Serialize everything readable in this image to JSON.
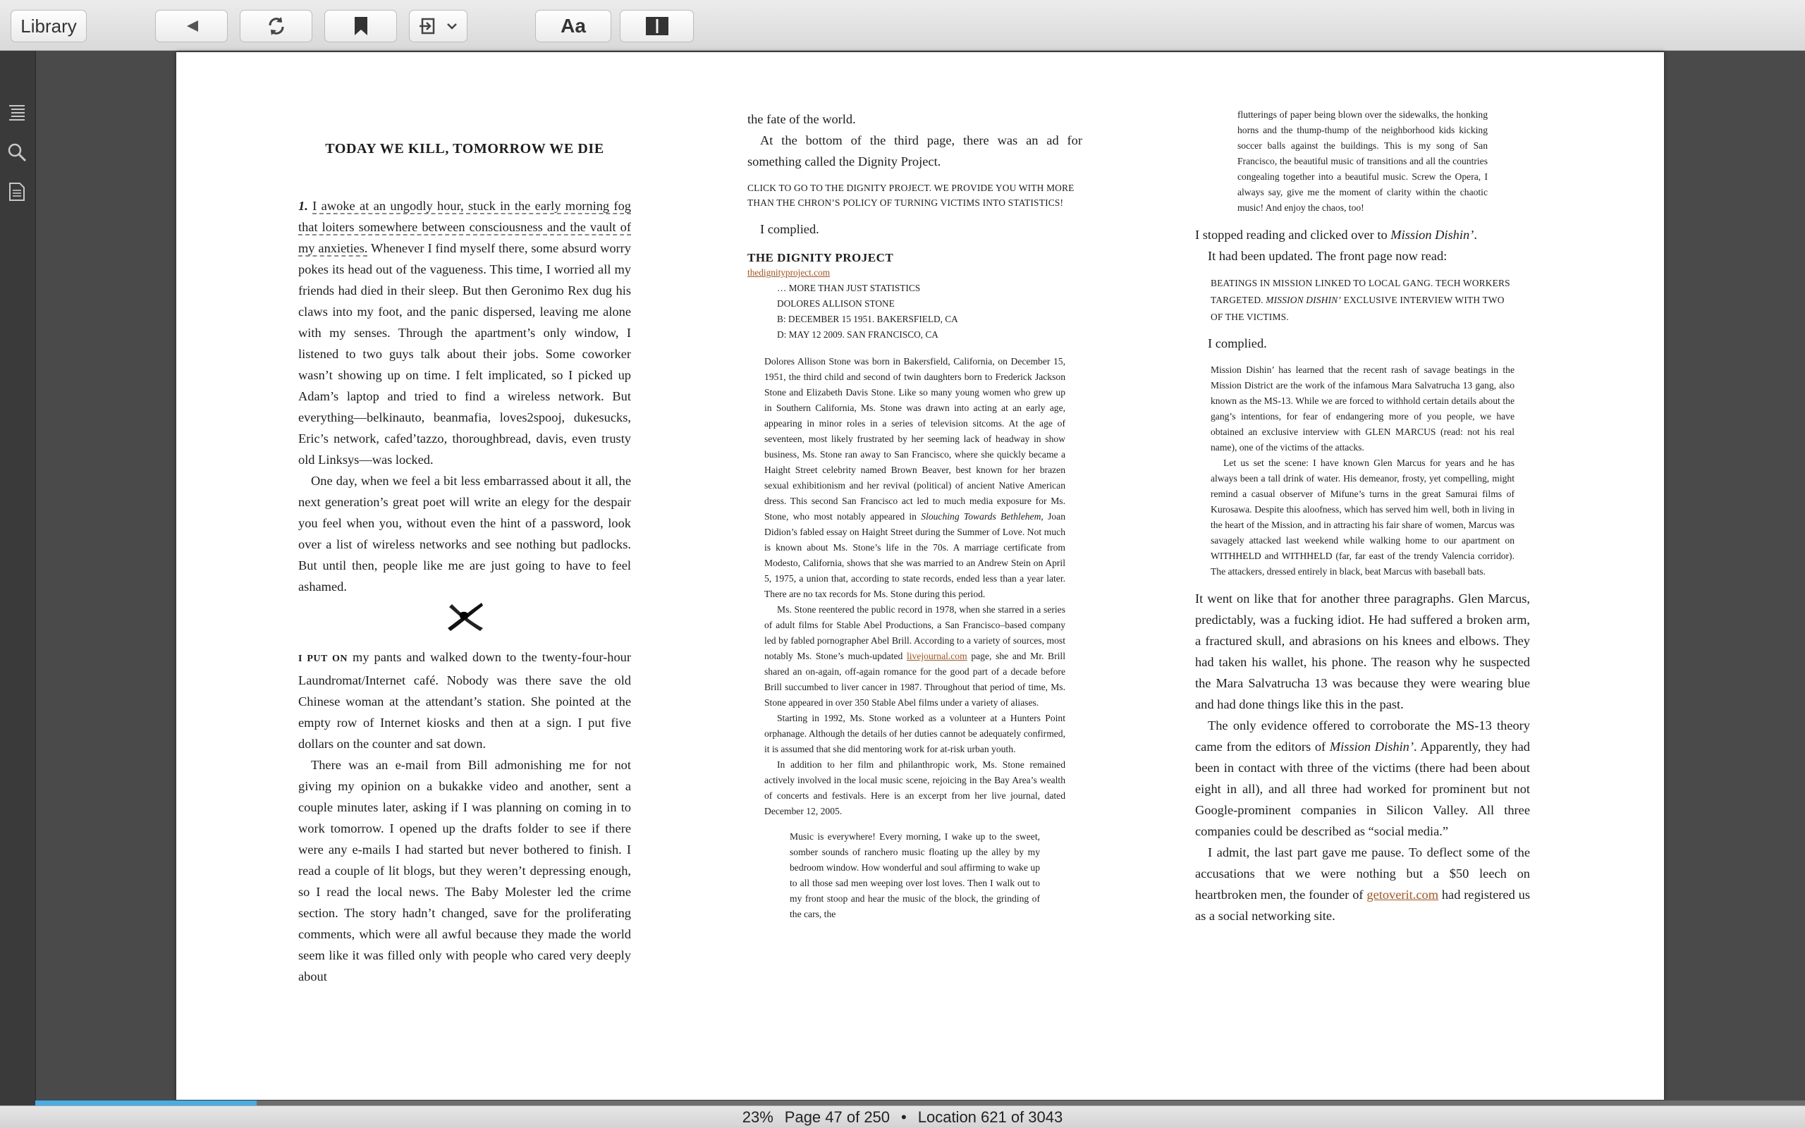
{
  "toolbar": {
    "library_label": "Library",
    "font_label": "Aa",
    "icons": [
      "back-icon",
      "refresh-icon",
      "bookmark-icon",
      "export-icon",
      "chevron-down-icon",
      "font-icon",
      "layout-icon"
    ]
  },
  "sidebar": {
    "icons": [
      "toc-icon",
      "search-icon",
      "notes-icon"
    ]
  },
  "col1": {
    "chapter_title": "TODAY WE KILL, TOMORROW WE DIE",
    "p1_num": "1.",
    "p1_underlined": "I awoke at an ungodly hour, stuck in the early morning fog that loiters somewhere between consciousness and the vault of my anxieties.",
    "p1_rest": " Whenever I find myself there, some absurd worry pokes its head out of the vagueness. This time, I worried all my friends had died in their sleep. But then Geronimo Rex dug his claws into my foot, and the panic dispersed, leaving me alone with my senses. Through the apartment’s only window, I listened to two guys talk about their jobs. Some coworker wasn’t showing up on time. I felt implicated, so I picked up Adam’s laptop and tried to find a wireless network. But everything—belkinauto, beanmafia, loves2spooj, dukesucks, Eric’s network, cafed’tazzo, thoroughbread, davis, even trusty old Linksys—was locked.",
    "p2": "One day, when we feel a bit less embarrassed about it all, the next generation’s great poet will write an elegy for the despair you feel when you, without even the hint of a password, look over a list of wireless networks and see nothing but padlocks. But until then, people like me are just going to have to feel ashamed.",
    "p3_caps": "I PUT ON",
    "p3_rest": " my pants and walked down to the twenty-four-hour Laundromat/Internet café. Nobody was there save the old Chinese woman at the attendant’s station. She pointed at the empty row of Internet kiosks and then at a sign. I put five dollars on the counter and sat down.",
    "p4": "There was an e-mail from Bill admonishing me for not giving my opinion on a bukakke video and another, sent a couple minutes later, asking if I was planning on coming in to work tomorrow. I opened up the drafts folder to see if there were any e-mails I had started but never bothered to finish. I read a couple of lit blogs, but they weren’t depressing enough, so I read the local news. The Baby Molester led the crime section. The story hadn’t changed, save for the proliferating comments, which were all awful because they made the world seem like it was filled only with people who cared very deeply about"
  },
  "col2": {
    "p1": "the fate of the world.",
    "p2": "At the bottom of the third page, there was an ad for something called the Dignity Project.",
    "ad": "CLICK TO GO TO THE DIGNITY PROJECT. WE PROVIDE YOU WITH MORE THAN THE CHRON’S POLICY OF TURNING VICTIMS INTO STATISTICS!",
    "complied": "I complied.",
    "dp_title": "THE DIGNITY PROJECT",
    "dp_link": "thedignityproject.com",
    "dp_line1": "… MORE THAN JUST STATISTICS",
    "dp_line2": "DOLORES ALLISON STONE",
    "dp_line3": "B: DECEMBER 15 1951. BAKERSFIELD, CA",
    "dp_line4": "D: MAY 12 2009. SAN FRANCISCO, CA",
    "bio1_a": "Dolores Allison Stone was born in Bakersfield, California, on December 15, 1951, the third child and second of twin daughters born to Frederick Jackson Stone and Elizabeth Davis Stone. Like so many young women who grew up in Southern California, Ms. Stone was drawn into acting at an early age, appearing in minor roles in a series of television sitcoms. At the age of seventeen, most likely frustrated by her seeming lack of headway in show business, Ms. Stone ran away to San Francisco, where she quickly became a Haight Street celebrity named Brown Beaver, best known for her brazen sexual exhibitionism and her revival (political) of ancient Native American dress. This second San Francisco act led to much media exposure for Ms. Stone, who most notably appeared in ",
    "bio1_italic": "Slouching Towards Bethlehem",
    "bio1_b": ", Joan Didion’s fabled essay on Haight Street during the Summer of Love. Not much is known about Ms. Stone’s life in the 70s. A marriage certificate from Modesto, California, shows that she was married to an Andrew Stein on April 5, 1975, a union that, according to state records, ended less than a year later. There are no tax records for Ms. Stone during this period.",
    "bio2_a": "Ms. Stone reentered the public record in 1978, when she starred in a series of adult films for Stable Abel Productions, a San Francisco–based company led by fabled pornographer Abel Brill. According to a variety of sources, most notably Ms. Stone’s much-updated ",
    "bio2_link": "livejournal.com",
    "bio2_b": " page, she and Mr. Brill shared an on-again, off-again romance for the good part of a decade before Brill succumbed to liver cancer in 1987. Throughout that period of time, Ms. Stone appeared in over 350 Stable Abel films under a variety of aliases.",
    "bio3": "Starting in 1992, Ms. Stone worked as a volunteer at a Hunters Point orphanage. Although the details of her duties cannot be adequately confirmed, it is assumed that she did mentoring work for at-risk urban youth.",
    "bio4": "In addition to her film and philanthropic work, Ms. Stone remained actively involved in the local music scene, rejoicing in the Bay Area’s wealth of concerts and festivals. Here is an excerpt from her live journal, dated December 12, 2005.",
    "quote": "Music is everywhere! Every morning, I wake up to the sweet, somber sounds of ranchero music floating up the alley by my bedroom window. How wonderful and soul affirming to wake up to all those sad men weeping over lost loves. Then I walk out to my front stoop and hear the music of the block, the grinding of the cars, the"
  },
  "col3": {
    "quote_cont": "flutterings of paper being blown over the sidewalks, the honking horns and the thump-thump of the neighborhood kids kicking soccer balls against the buildings. This is my song of San Francisco, the beautiful music of transitions and all the countries congealing together into a beautiful music. Screw the Opera, I always say, give me the moment of clarity within the chaotic music! And enjoy the chaos, too!",
    "p1_a": "I stopped reading and clicked over to ",
    "p1_italic": "Mission Dishin’",
    "p1_b": ".",
    "p2": "It had been updated. The front page now read:",
    "head_a": "BEATINGS IN MISSION LINKED TO LOCAL GANG. TECH WORKERS TARGETED. ",
    "head_italic": "MISSION DISHIN’",
    "head_b": " EXCLUSIVE INTERVIEW WITH TWO OF THE VICTIMS.",
    "complied": "I complied.",
    "art1": "Mission Dishin’ has learned that the recent rash of savage beatings in the Mission District are the work of the infamous Mara Salvatrucha 13 gang, also known as the MS-13. While we are forced to withhold certain details about the gang’s intentions, for fear of endangering more of you people, we have obtained an exclusive interview with GLEN MARCUS (read: not his real name), one of the victims of the attacks.",
    "art2": "Let us set the scene: I have known Glen Marcus for years and he has always been a tall drink of water. His demeanor, frosty, yet compelling, might remind a casual observer of Mifune’s turns in the great Samurai films of Kurosawa. Despite this aloofness, which has served him well, both in living in the heart of the Mission, and in attracting his fair share of women, Marcus was savagely attacked last weekend while walking home to our apartment on WITHHELD and WITHHELD (far, far east of the trendy Valencia corridor). The attackers, dressed entirely in black, beat Marcus with baseball bats.",
    "p3": "It went on like that for another three paragraphs. Glen Marcus, predictably, was a fucking idiot. He had suffered a broken arm, a fractured skull, and abrasions on his knees and elbows. They had taken his wallet, his phone. The reason why he suspected the Mara Salvatrucha 13 was because they were wearing blue and had done things like this in the past.",
    "p4_a": "The only evidence offered to corroborate the MS-13 theory came from the editors of ",
    "p4_italic": "Mission Dishin’",
    "p4_b": ". Apparently, they had been in contact with three of the victims (there had been about eight in all), and all three had worked for prominent but not Google-prominent companies in Silicon Valley. All three companies could be described as “social media.”",
    "p5_a": "I admit, the last part gave me pause. To deflect some of the accusations that we were nothing but a $50 leech on heartbroken men, the founder of ",
    "p5_link": "getoverit.com",
    "p5_b": " had registered us as a social networking site."
  },
  "status": {
    "percent": "23%",
    "page": "Page 47 of 250",
    "separator": "•",
    "location": "Location 621 of 3043",
    "progress": 0.125
  }
}
